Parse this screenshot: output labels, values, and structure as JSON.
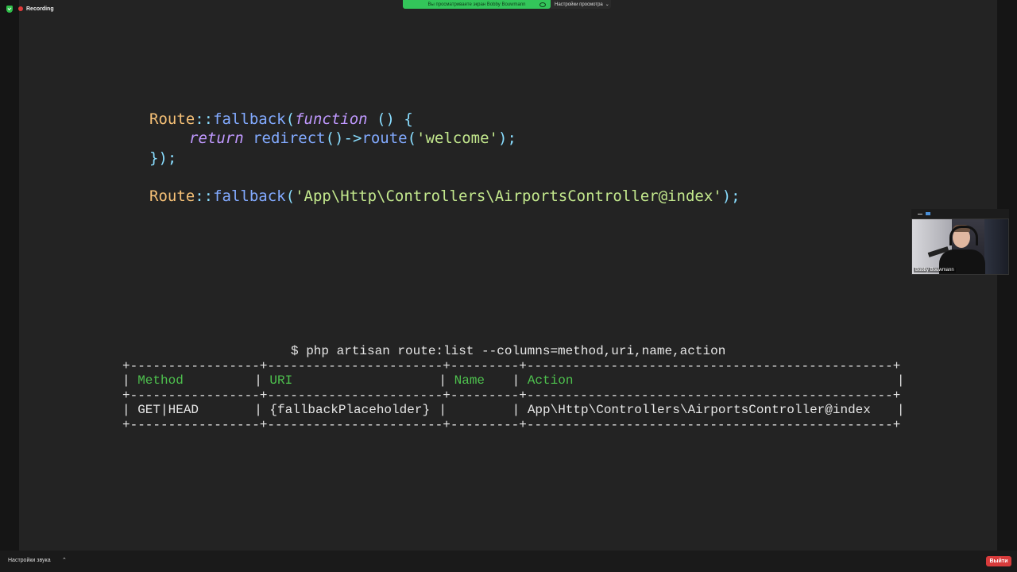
{
  "recording": {
    "label": "Recording"
  },
  "share_banner": {
    "text": "Вы просматриваете экран Bobby Bouwmann",
    "view_options": "Настройки просмотра"
  },
  "code": {
    "line1": {
      "cls": "Route",
      "op": "::",
      "fn": "fallback",
      "p1": "(",
      "kw": "function",
      "rest": " () {"
    },
    "line2": {
      "kw": "return",
      "fn1": "redirect",
      "p": "()",
      "arrow": "->",
      "fn2": "route",
      "p_open": "(",
      "str": "'welcome'",
      "p_close": ");"
    },
    "line3": {
      "text": "});"
    },
    "line4": {
      "cls": "Route",
      "op": "::",
      "fn": "fallback",
      "p1": "(",
      "str": "'App\\Http\\Controllers\\AirportsController@index'",
      "p2": ");"
    }
  },
  "terminal": {
    "command": "$ php artisan route:list --columns=method,uri,name,action",
    "border": "+-----------------+-----------------------+---------+------------------------------------------------+",
    "headers": {
      "method": "Method",
      "uri": "URI",
      "name": "Name",
      "action": "Action"
    },
    "row": {
      "method": "GET|HEAD",
      "uri": "{fallbackPlaceholder}",
      "name": "",
      "action": "App\\Http\\Controllers\\AirportsController@index"
    }
  },
  "camera": {
    "name": "Bobby Bouwmann"
  },
  "bottom": {
    "audio_settings": "Настройки звука",
    "exit": "Выйти"
  },
  "colors": {
    "share_green": "#33c55a",
    "exit_red": "#d83b3b",
    "code_yellow": "#f6c177",
    "code_purple": "#c099ff",
    "code_string": "#c3e88d",
    "term_green": "#4ec14e"
  }
}
